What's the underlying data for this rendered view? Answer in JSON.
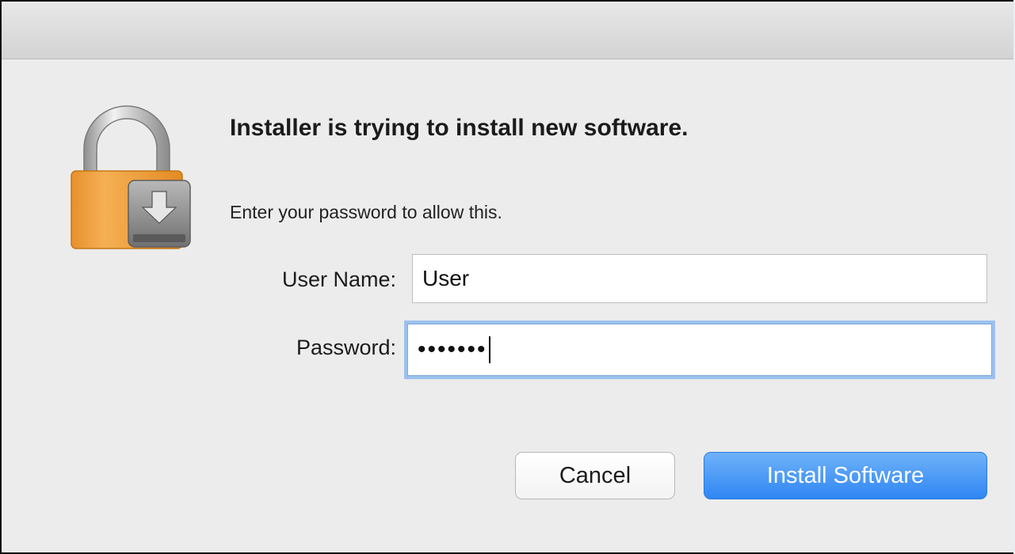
{
  "dialog": {
    "title": "Installer is trying to install new software.",
    "message": "Enter your password to allow this.",
    "icon": "lock-installer-icon"
  },
  "form": {
    "username_label": "User Name:",
    "username_value": "User",
    "password_label": "Password:",
    "password_value": "•••••••"
  },
  "buttons": {
    "cancel_label": "Cancel",
    "install_label": "Install Software"
  },
  "colors": {
    "accent": "#3a8cf5",
    "focus_ring": "#9cc1ee",
    "lock_body": "#f0a23c"
  }
}
